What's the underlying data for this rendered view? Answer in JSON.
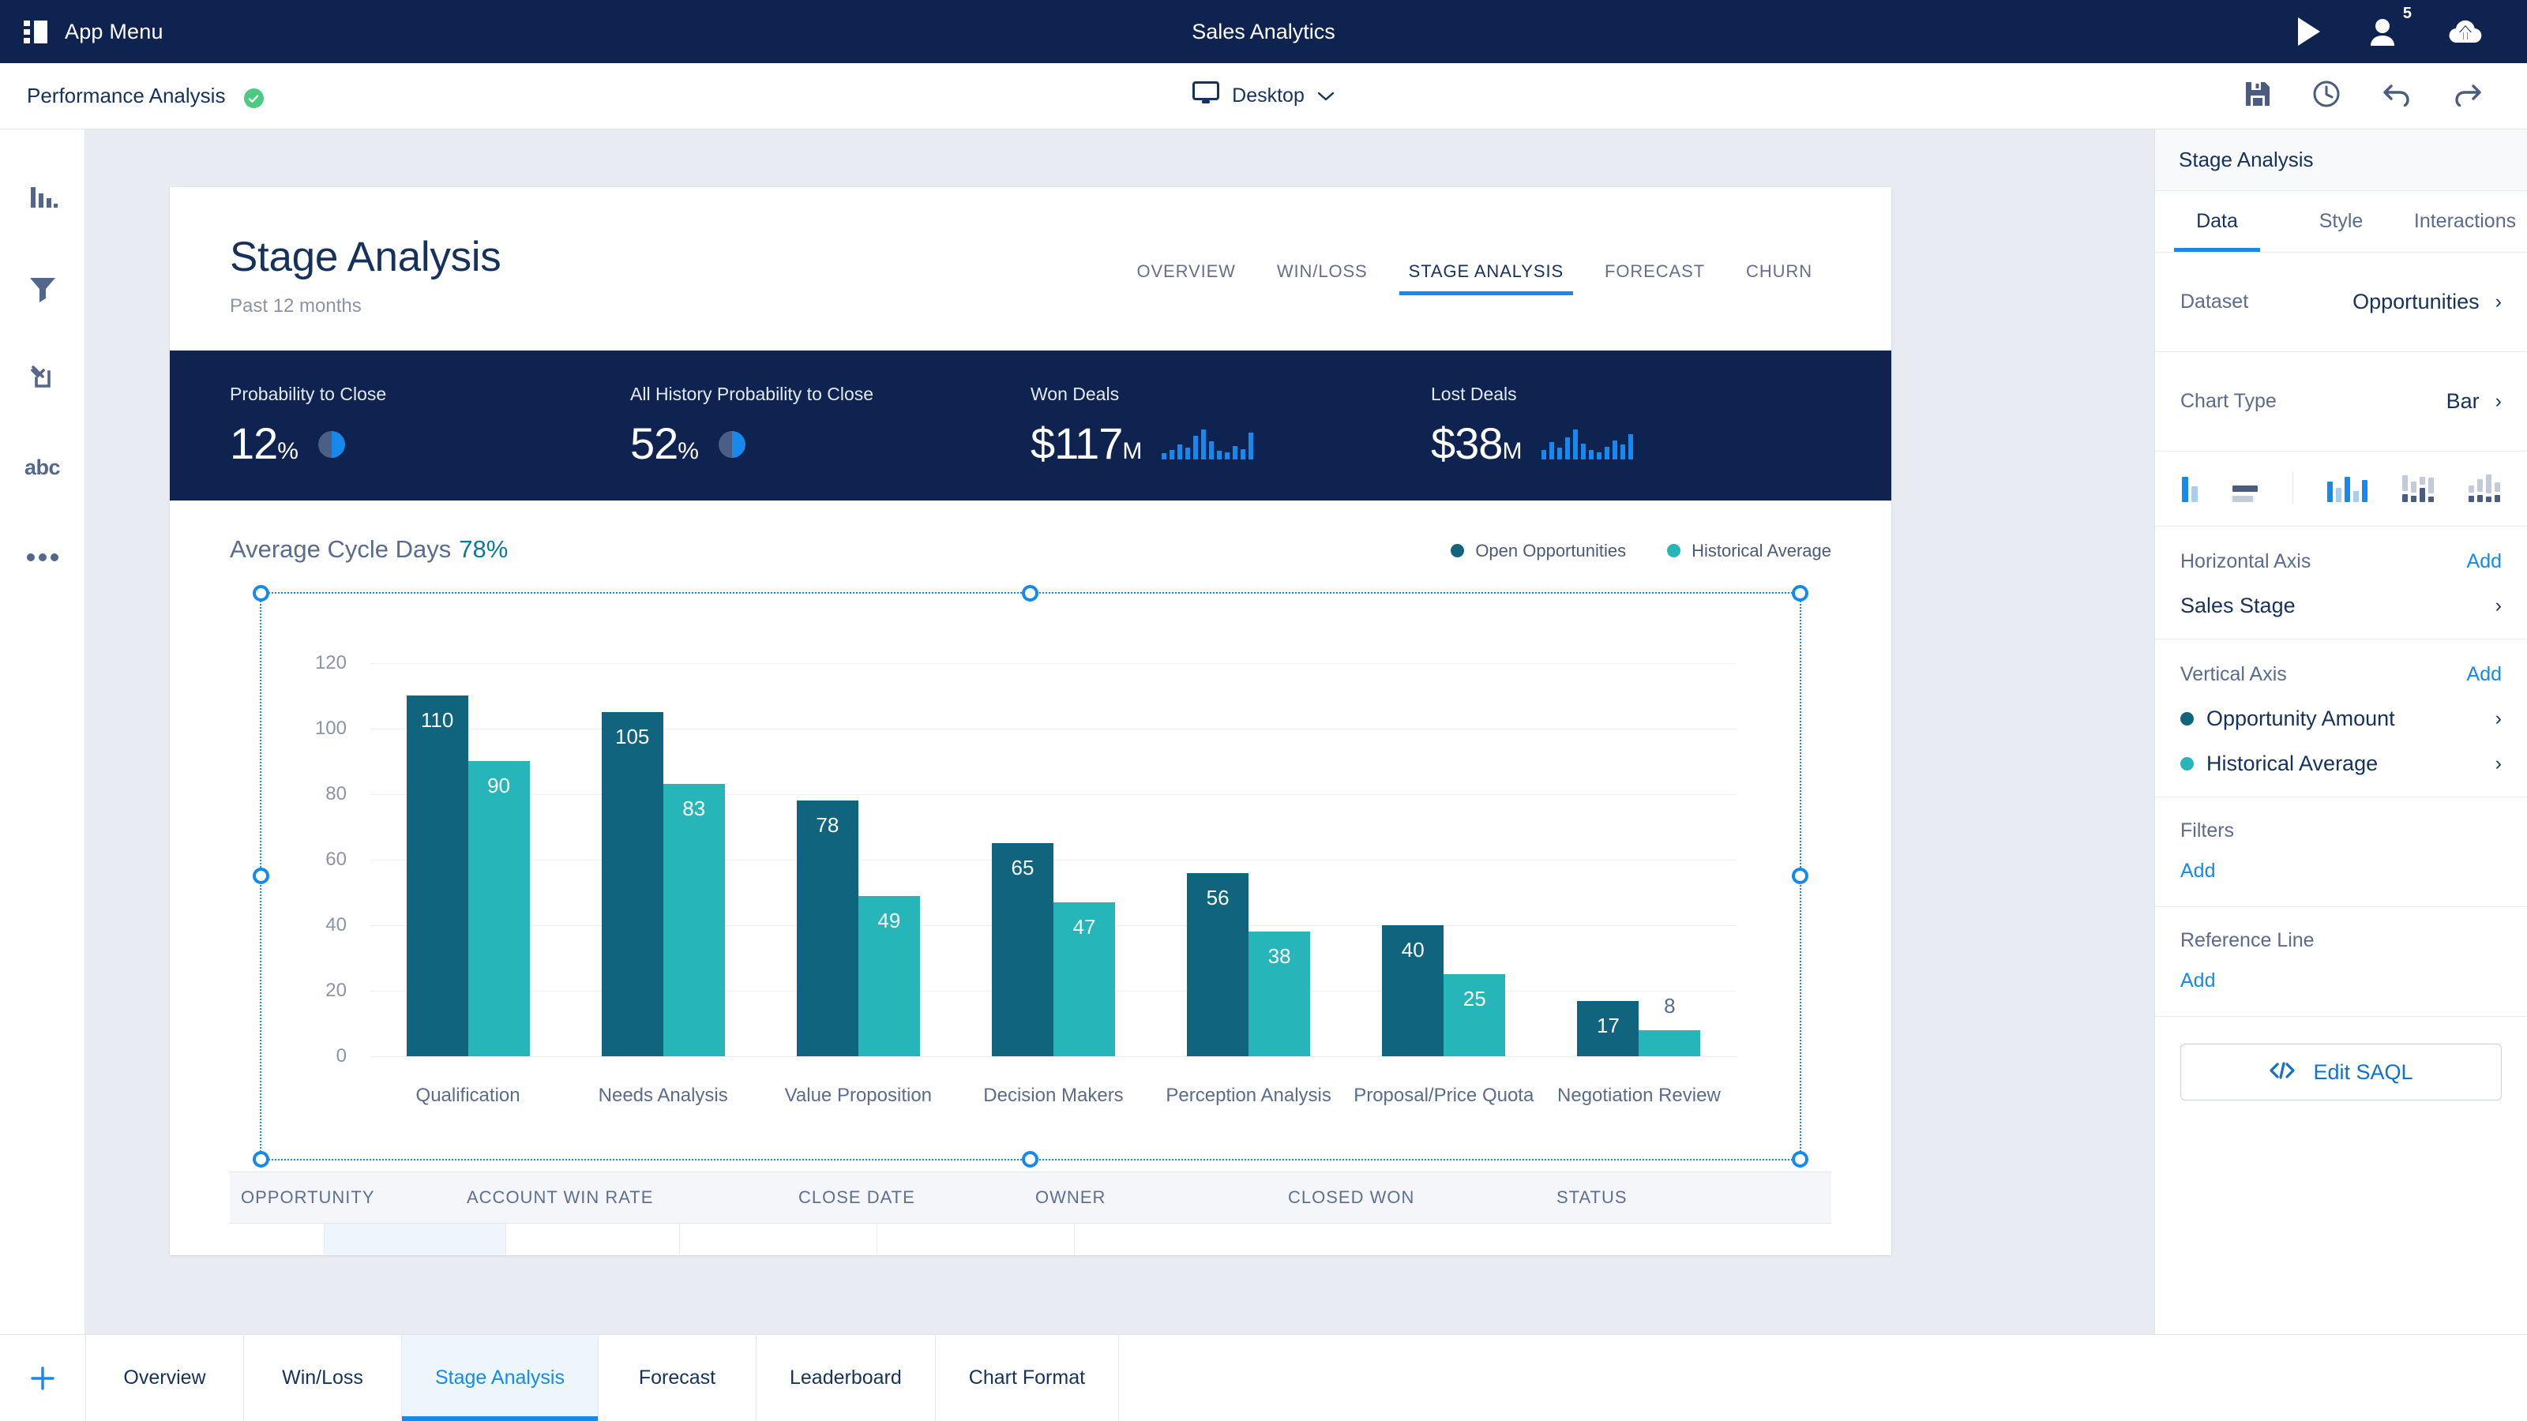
{
  "topbar": {
    "app_menu_label": "App Menu",
    "title": "Sales Analytics",
    "play_icon": "play-icon",
    "people_icon": "people-icon",
    "people_count": "5",
    "upload_icon": "cloud-upload-icon"
  },
  "subbar": {
    "doc_title": "Performance Analysis",
    "verified_icon": "verified-check-icon",
    "device": "Desktop",
    "device_icon": "desktop-icon",
    "chevron": "∨",
    "actions": [
      "save-icon",
      "history-clock-icon",
      "undo-icon",
      "redo-icon"
    ]
  },
  "rail": {
    "items": [
      {
        "name": "chart-icon",
        "label": ""
      },
      {
        "name": "filter-icon",
        "label": ""
      },
      {
        "name": "link-nav-icon",
        "label": ""
      },
      {
        "name": "text-abc-icon",
        "label": "abc"
      },
      {
        "name": "more-icon",
        "label": ""
      }
    ]
  },
  "dashboard": {
    "title": "Stage Analysis",
    "subtitle": "Past 12 months",
    "tabs": [
      {
        "label": "OVERVIEW",
        "active": false
      },
      {
        "label": "WIN/LOSS",
        "active": false
      },
      {
        "label": "STAGE ANALYSIS",
        "active": true
      },
      {
        "label": "FORECAST",
        "active": false
      },
      {
        "label": "CHURN",
        "active": false
      }
    ],
    "kpis": [
      {
        "label": "Probability to Close",
        "value": "12",
        "unit": "%",
        "viz": "donut"
      },
      {
        "label": "All History Probability to Close",
        "value": "52",
        "unit": "%",
        "viz": "donut"
      },
      {
        "label": "Won Deals",
        "value": "$117",
        "unit": "M",
        "viz": "sparkline"
      },
      {
        "label": "Lost Deals",
        "value": "$38",
        "unit": "M",
        "viz": "sparkline"
      }
    ],
    "sparkline_won": [
      6,
      9,
      14,
      11,
      22,
      28,
      17,
      8,
      7,
      13,
      10,
      25
    ],
    "sparkline_lost": [
      9,
      16,
      11,
      21,
      28,
      15,
      9,
      7,
      12,
      18,
      14,
      24
    ],
    "table": {
      "columns": [
        "OPPORTUNITY",
        "ACCOUNT WIN RATE",
        "CLOSE DATE",
        "OWNER",
        "CLOSED WON",
        "STATUS"
      ]
    }
  },
  "chart_data": {
    "type": "bar",
    "title": "Average Cycle Days",
    "title_metric": "78%",
    "xlabel": "",
    "ylabel": "",
    "ylim": [
      0,
      130
    ],
    "yticks": [
      0,
      20,
      40,
      60,
      80,
      100,
      120
    ],
    "grid": true,
    "legend_position": "top-right",
    "categories": [
      "Qualification",
      "Needs Analysis",
      "Value Proposition",
      "Decision Makers",
      "Perception Analysis",
      "Proposal/Price Quota",
      "Negotiation Review"
    ],
    "series": [
      {
        "name": "Open Opportunities",
        "color": "#10647e",
        "values": [
          110,
          105,
          78,
          65,
          56,
          40,
          17
        ]
      },
      {
        "name": "Historical Average",
        "color": "#26b5b8",
        "values": [
          90,
          83,
          49,
          47,
          38,
          25,
          8
        ]
      }
    ]
  },
  "right_panel": {
    "header": "Stage Analysis",
    "tabs": [
      {
        "label": "Data",
        "active": true
      },
      {
        "label": "Style",
        "active": false
      },
      {
        "label": "Interactions",
        "active": false
      }
    ],
    "dataset": {
      "key": "Dataset",
      "value": "Opportunities",
      "chevron": "›"
    },
    "chart_type": {
      "key": "Chart Type",
      "value": "Bar",
      "chevron": "›"
    },
    "chart_type_icons": [
      "bar-horizontal-icon",
      "bar-stacked-horizontal-icon",
      "bar-vertical-grouped-icon",
      "bar-vertical-stacked-icon",
      "bar-vertical-waterfall-icon"
    ],
    "horizontal_axis": {
      "title": "Horizontal Axis",
      "add": "Add",
      "fields": [
        {
          "label": "Sales Stage",
          "color": null,
          "chevron": "›"
        }
      ]
    },
    "vertical_axis": {
      "title": "Vertical Axis",
      "add": "Add",
      "fields": [
        {
          "label": "Opportunity Amount",
          "color": "#10647e",
          "chevron": "›"
        },
        {
          "label": "Historical Average",
          "color": "#26b5b8",
          "chevron": "›"
        }
      ]
    },
    "filters": {
      "title": "Filters",
      "add": "Add"
    },
    "reference_line": {
      "title": "Reference Line",
      "add": "Add"
    },
    "edit_saql": {
      "label": "Edit SAQL",
      "icon": "code-icon"
    }
  },
  "bottom_tabs": {
    "add_icon": "plus-icon",
    "items": [
      {
        "label": "Overview",
        "active": false
      },
      {
        "label": "Win/Loss",
        "active": false
      },
      {
        "label": "Stage Analysis",
        "active": true
      },
      {
        "label": "Forecast",
        "active": false
      },
      {
        "label": "Leaderboard",
        "active": false
      },
      {
        "label": "Chart Format",
        "active": false
      }
    ]
  },
  "colors": {
    "navy": "#0e2350",
    "accent_blue": "#1589ee",
    "series_a": "#10647e",
    "series_b": "#26b5b8",
    "verified_green": "#4bca81"
  }
}
